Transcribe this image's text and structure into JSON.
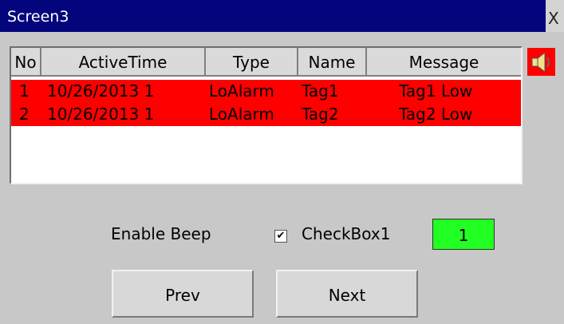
{
  "window": {
    "title": "Screen3",
    "close_label": "X"
  },
  "alarm_table": {
    "columns": [
      "No",
      "ActiveTime",
      "Type",
      "Name",
      "Message"
    ],
    "rows": [
      {
        "no": "1",
        "active_time": "10/26/2013 1",
        "type": "LoAlarm",
        "name": "Tag1",
        "message": "Tag1 Low"
      },
      {
        "no": "2",
        "active_time": "10/26/2013 1",
        "type": "LoAlarm",
        "name": "Tag2",
        "message": "Tag2 Low"
      }
    ],
    "row_color": "#ff0000"
  },
  "controls": {
    "enable_beep_label": "Enable Beep",
    "checkbox_label": "CheckBox1",
    "checkbox_checked": true,
    "status_value": "1",
    "status_color": "#22ff22",
    "prev_label": "Prev",
    "next_label": "Next"
  },
  "icons": {
    "speaker": "speaker-icon"
  }
}
